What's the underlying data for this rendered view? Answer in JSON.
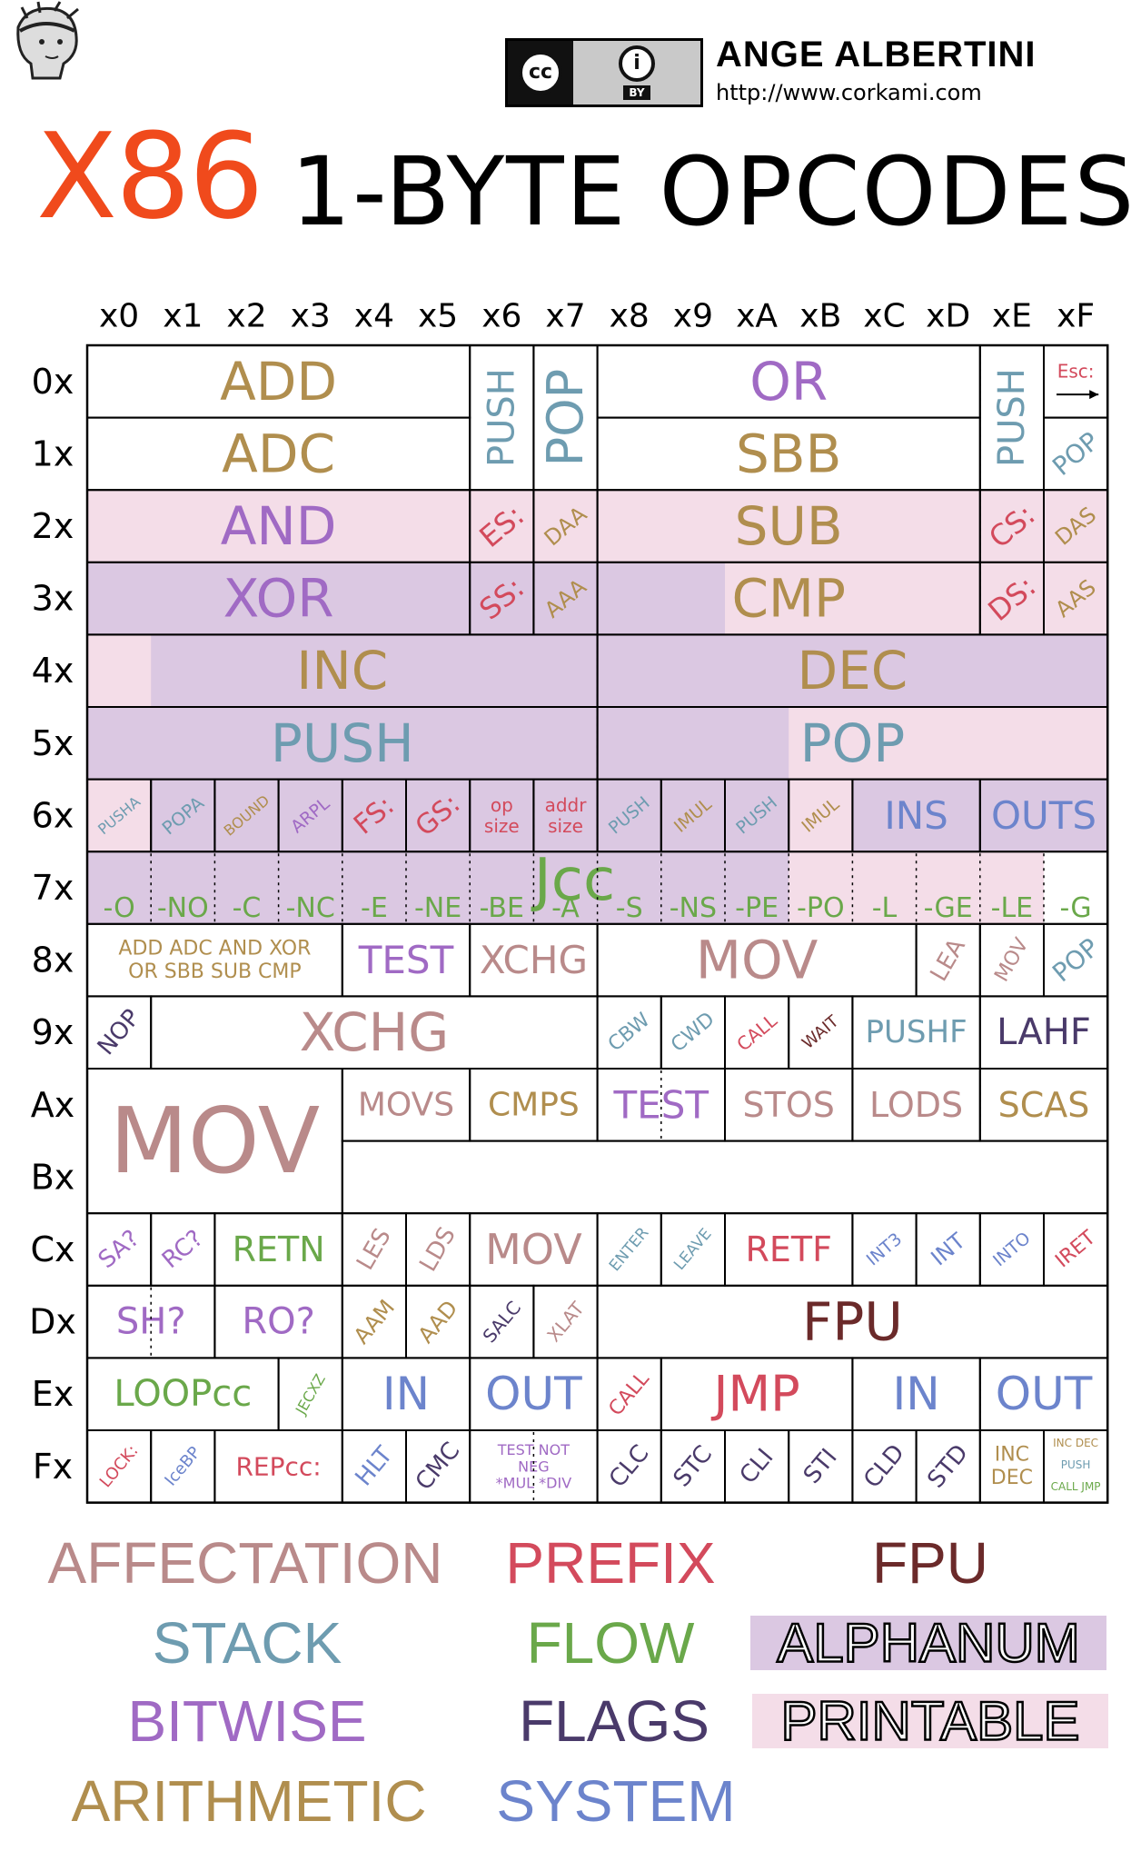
{
  "header": {
    "title_x86": "X86",
    "title_rest": "1-BYTE OPCODES",
    "author": "ANGE ALBERTINI",
    "url": "http://www.corkami.com",
    "license_cc": "cc",
    "license_by": "BY"
  },
  "colors": {
    "affectation": "#b98a8a",
    "prefix": "#d34a5c",
    "fpu": "#6b2a2a",
    "stack": "#6e9cb0",
    "flow": "#6aa84a",
    "bitwise": "#a06ac4",
    "flags": "#4a3a6a",
    "arithmetic": "#b08e4e",
    "system": "#6c84cc",
    "alphanum_bg": "#dbc8e2",
    "printable_bg": "#f4dde8"
  },
  "columns": [
    "x0",
    "x1",
    "x2",
    "x3",
    "x4",
    "x5",
    "x6",
    "x7",
    "x8",
    "x9",
    "xA",
    "xB",
    "xC",
    "xD",
    "xE",
    "xF"
  ],
  "rows": [
    "0x",
    "1x",
    "2x",
    "3x",
    "4x",
    "5x",
    "6x",
    "7x",
    "8x",
    "9x",
    "Ax",
    "Bx",
    "Cx",
    "Dx",
    "Ex",
    "Fx"
  ],
  "backgrounds": [
    {
      "r": 2,
      "c": 0,
      "w": 16,
      "h": 1,
      "cat": "printable_bg"
    },
    {
      "r": 3,
      "c": 0,
      "w": 16,
      "h": 1,
      "cat": "printable_bg"
    },
    {
      "r": 3,
      "c": 0,
      "w": 10,
      "h": 1,
      "cat": "alphanum_bg"
    },
    {
      "r": 4,
      "c": 0,
      "w": 16,
      "h": 2,
      "cat": "printable_bg"
    },
    {
      "r": 4,
      "c": 1,
      "w": 15,
      "h": 1,
      "cat": "alphanum_bg"
    },
    {
      "r": 5,
      "c": 0,
      "w": 11,
      "h": 1,
      "cat": "alphanum_bg"
    },
    {
      "r": 6,
      "c": 0,
      "w": 16,
      "h": 2,
      "cat": "printable_bg"
    },
    {
      "r": 6,
      "c": 1,
      "w": 10,
      "h": 1,
      "cat": "alphanum_bg"
    },
    {
      "r": 6,
      "c": 12,
      "w": 4,
      "h": 1,
      "cat": "alphanum_bg"
    },
    {
      "r": 7,
      "c": 0,
      "w": 11,
      "h": 1,
      "cat": "alphanum_bg"
    },
    {
      "r": 7,
      "c": 15,
      "w": 1,
      "h": 1,
      "cat": "white"
    }
  ],
  "cells": [
    {
      "r": 0,
      "c": 0,
      "w": 6,
      "h": 1,
      "lines": [
        "ADD"
      ],
      "cat": "arithmetic",
      "size": 58
    },
    {
      "r": 1,
      "c": 0,
      "w": 6,
      "h": 1,
      "lines": [
        "ADC"
      ],
      "cat": "arithmetic",
      "size": 58
    },
    {
      "r": 2,
      "c": 0,
      "w": 6,
      "h": 1,
      "lines": [
        "AND"
      ],
      "cat": "bitwise",
      "size": 58
    },
    {
      "r": 3,
      "c": 0,
      "w": 6,
      "h": 1,
      "lines": [
        "XOR"
      ],
      "cat": "bitwise",
      "size": 58
    },
    {
      "r": 0,
      "c": 6,
      "w": 1,
      "h": 2,
      "lines": [
        "PUSH"
      ],
      "cat": "stack",
      "size": 40,
      "rot": -90
    },
    {
      "r": 0,
      "c": 7,
      "w": 1,
      "h": 2,
      "lines": [
        "POP"
      ],
      "cat": "stack",
      "size": 54,
      "rot": -90
    },
    {
      "r": 2,
      "c": 6,
      "w": 1,
      "h": 1,
      "lines": [
        "ES:"
      ],
      "cat": "prefix",
      "size": 32,
      "rot": -40
    },
    {
      "r": 2,
      "c": 7,
      "w": 1,
      "h": 1,
      "lines": [
        "DAA"
      ],
      "cat": "arithmetic",
      "size": 24,
      "rot": -40
    },
    {
      "r": 3,
      "c": 6,
      "w": 1,
      "h": 1,
      "lines": [
        "SS:"
      ],
      "cat": "prefix",
      "size": 32,
      "rot": -40
    },
    {
      "r": 3,
      "c": 7,
      "w": 1,
      "h": 1,
      "lines": [
        "AAA"
      ],
      "cat": "arithmetic",
      "size": 24,
      "rot": -40
    },
    {
      "r": 0,
      "c": 8,
      "w": 6,
      "h": 1,
      "lines": [
        "OR"
      ],
      "cat": "bitwise",
      "size": 58
    },
    {
      "r": 1,
      "c": 8,
      "w": 6,
      "h": 1,
      "lines": [
        "SBB"
      ],
      "cat": "arithmetic",
      "size": 58
    },
    {
      "r": 2,
      "c": 8,
      "w": 6,
      "h": 1,
      "lines": [
        "SUB"
      ],
      "cat": "arithmetic",
      "size": 58
    },
    {
      "r": 3,
      "c": 8,
      "w": 6,
      "h": 1,
      "lines": [
        "CMP"
      ],
      "cat": "arithmetic",
      "size": 58
    },
    {
      "r": 0,
      "c": 14,
      "w": 1,
      "h": 2,
      "lines": [
        "PUSH"
      ],
      "cat": "stack",
      "size": 40,
      "rot": -90
    },
    {
      "r": 0,
      "c": 15,
      "w": 1,
      "h": 1,
      "lines": [
        "Esc:"
      ],
      "cat": "prefix",
      "size": 20,
      "arrow": true
    },
    {
      "r": 1,
      "c": 15,
      "w": 1,
      "h": 1,
      "lines": [
        "POP"
      ],
      "cat": "stack",
      "size": 28,
      "rot": -40
    },
    {
      "r": 2,
      "c": 14,
      "w": 1,
      "h": 1,
      "lines": [
        "CS:"
      ],
      "cat": "prefix",
      "size": 32,
      "rot": -40
    },
    {
      "r": 2,
      "c": 15,
      "w": 1,
      "h": 1,
      "lines": [
        "DAS"
      ],
      "cat": "arithmetic",
      "size": 24,
      "rot": -40
    },
    {
      "r": 3,
      "c": 14,
      "w": 1,
      "h": 1,
      "lines": [
        "DS:"
      ],
      "cat": "prefix",
      "size": 32,
      "rot": -40
    },
    {
      "r": 3,
      "c": 15,
      "w": 1,
      "h": 1,
      "lines": [
        "AAS"
      ],
      "cat": "arithmetic",
      "size": 24,
      "rot": -40
    },
    {
      "r": 4,
      "c": 0,
      "w": 8,
      "h": 1,
      "lines": [
        "INC"
      ],
      "cat": "arithmetic",
      "size": 58
    },
    {
      "r": 4,
      "c": 8,
      "w": 8,
      "h": 1,
      "lines": [
        "DEC"
      ],
      "cat": "arithmetic",
      "size": 58
    },
    {
      "r": 5,
      "c": 0,
      "w": 8,
      "h": 1,
      "lines": [
        "PUSH"
      ],
      "cat": "stack",
      "size": 58
    },
    {
      "r": 5,
      "c": 8,
      "w": 8,
      "h": 1,
      "lines": [
        "POP"
      ],
      "cat": "stack",
      "size": 58
    },
    {
      "r": 6,
      "c": 0,
      "w": 1,
      "h": 1,
      "lines": [
        "PUSHA"
      ],
      "cat": "stack",
      "size": 16,
      "rot": -40
    },
    {
      "r": 6,
      "c": 1,
      "w": 1,
      "h": 1,
      "lines": [
        "POPA"
      ],
      "cat": "stack",
      "size": 20,
      "rot": -40
    },
    {
      "r": 6,
      "c": 2,
      "w": 1,
      "h": 1,
      "lines": [
        "BOUND"
      ],
      "cat": "arithmetic",
      "size": 16,
      "rot": -40
    },
    {
      "r": 6,
      "c": 3,
      "w": 1,
      "h": 1,
      "lines": [
        "ARPL"
      ],
      "cat": "bitwise",
      "size": 19,
      "rot": -40
    },
    {
      "r": 6,
      "c": 4,
      "w": 1,
      "h": 1,
      "lines": [
        "FS:"
      ],
      "cat": "prefix",
      "size": 30,
      "rot": -40
    },
    {
      "r": 6,
      "c": 5,
      "w": 1,
      "h": 1,
      "lines": [
        "GS:"
      ],
      "cat": "prefix",
      "size": 30,
      "rot": -40
    },
    {
      "r": 6,
      "c": 6,
      "w": 1,
      "h": 1,
      "lines": [
        "op",
        "size"
      ],
      "cat": "prefix",
      "size": 20
    },
    {
      "r": 6,
      "c": 7,
      "w": 1,
      "h": 1,
      "lines": [
        "addr",
        "size"
      ],
      "cat": "prefix",
      "size": 20
    },
    {
      "r": 6,
      "c": 8,
      "w": 1,
      "h": 1,
      "lines": [
        "PUSH"
      ],
      "cat": "stack",
      "size": 19,
      "rot": -40
    },
    {
      "r": 6,
      "c": 9,
      "w": 1,
      "h": 1,
      "lines": [
        "IMUL"
      ],
      "cat": "arithmetic",
      "size": 19,
      "rot": -40
    },
    {
      "r": 6,
      "c": 10,
      "w": 1,
      "h": 1,
      "lines": [
        "PUSH"
      ],
      "cat": "stack",
      "size": 19,
      "rot": -40
    },
    {
      "r": 6,
      "c": 11,
      "w": 1,
      "h": 1,
      "lines": [
        "IMUL"
      ],
      "cat": "arithmetic",
      "size": 19,
      "rot": -40
    },
    {
      "r": 6,
      "c": 12,
      "w": 2,
      "h": 1,
      "lines": [
        "INS"
      ],
      "cat": "system",
      "size": 42
    },
    {
      "r": 6,
      "c": 14,
      "w": 2,
      "h": 1,
      "lines": [
        "OUTS"
      ],
      "cat": "system",
      "size": 42
    },
    {
      "r": 8,
      "c": 0,
      "w": 4,
      "h": 1,
      "lines": [
        "ADD  ADC  AND  XOR",
        "OR   SBB  SUB  CMP"
      ],
      "cat": "arithmetic",
      "size": 22
    },
    {
      "r": 8,
      "c": 4,
      "w": 2,
      "h": 1,
      "lines": [
        "TEST"
      ],
      "cat": "bitwise",
      "size": 42
    },
    {
      "r": 8,
      "c": 6,
      "w": 2,
      "h": 1,
      "lines": [
        "XCHG"
      ],
      "cat": "affectation",
      "size": 42
    },
    {
      "r": 8,
      "c": 8,
      "w": 5,
      "h": 1,
      "lines": [
        "MOV"
      ],
      "cat": "affectation",
      "size": 58
    },
    {
      "r": 8,
      "c": 13,
      "w": 1,
      "h": 1,
      "lines": [
        "LEA"
      ],
      "cat": "affectation",
      "size": 26,
      "rot": -60
    },
    {
      "r": 8,
      "c": 14,
      "w": 1,
      "h": 1,
      "lines": [
        "MOV"
      ],
      "cat": "affectation",
      "size": 22,
      "rot": -60
    },
    {
      "r": 8,
      "c": 15,
      "w": 1,
      "h": 1,
      "lines": [
        "POP"
      ],
      "cat": "stack",
      "size": 28,
      "rot": -40
    },
    {
      "r": 9,
      "c": 0,
      "w": 1,
      "h": 1,
      "lines": [
        "NOP"
      ],
      "cat": "flags",
      "size": 26,
      "rot": -50
    },
    {
      "r": 9,
      "c": 1,
      "w": 7,
      "h": 1,
      "lines": [
        "XCHG"
      ],
      "cat": "affectation",
      "size": 58
    },
    {
      "r": 9,
      "c": 8,
      "w": 1,
      "h": 1,
      "lines": [
        "CBW"
      ],
      "cat": "stack",
      "size": 22,
      "rot": -40
    },
    {
      "r": 9,
      "c": 9,
      "w": 1,
      "h": 1,
      "lines": [
        "CWD"
      ],
      "cat": "stack",
      "size": 22,
      "rot": -40
    },
    {
      "r": 9,
      "c": 10,
      "w": 1,
      "h": 1,
      "lines": [
        "CALL"
      ],
      "cat": "prefix",
      "size": 20,
      "rot": -40
    },
    {
      "r": 9,
      "c": 11,
      "w": 1,
      "h": 1,
      "lines": [
        "WAIT"
      ],
      "cat": "fpu",
      "size": 18,
      "rot": -40
    },
    {
      "r": 9,
      "c": 12,
      "w": 2,
      "h": 1,
      "lines": [
        "PUSHF"
      ],
      "cat": "stack",
      "size": 34
    },
    {
      "r": 9,
      "c": 14,
      "w": 2,
      "h": 1,
      "lines": [
        "LAHF"
      ],
      "cat": "flags",
      "size": 40
    },
    {
      "r": 10,
      "c": 0,
      "w": 4,
      "h": 2,
      "lines": [
        "MOV"
      ],
      "cat": "affectation",
      "size": 100
    },
    {
      "r": 10,
      "c": 4,
      "w": 2,
      "h": 1,
      "lines": [
        "MOVS"
      ],
      "cat": "affectation",
      "size": 36
    },
    {
      "r": 10,
      "c": 6,
      "w": 2,
      "h": 1,
      "lines": [
        "CMPS"
      ],
      "cat": "arithmetic",
      "size": 36
    },
    {
      "r": 10,
      "c": 8,
      "w": 2,
      "h": 1,
      "lines": [
        "TEST"
      ],
      "cat": "bitwise",
      "size": 42
    },
    {
      "r": 10,
      "c": 10,
      "w": 2,
      "h": 1,
      "lines": [
        "STOS"
      ],
      "cat": "affectation",
      "size": 38
    },
    {
      "r": 10,
      "c": 12,
      "w": 2,
      "h": 1,
      "lines": [
        "LODS"
      ],
      "cat": "affectation",
      "size": 38
    },
    {
      "r": 10,
      "c": 14,
      "w": 2,
      "h": 1,
      "lines": [
        "SCAS"
      ],
      "cat": "arithmetic",
      "size": 38
    },
    {
      "r": 11,
      "c": 4,
      "w": 12,
      "h": 1,
      "lines": [
        ""
      ],
      "cat": "affectation",
      "size": 20
    },
    {
      "r": 12,
      "c": 0,
      "w": 1,
      "h": 1,
      "lines": [
        "SA?"
      ],
      "cat": "bitwise",
      "size": 26,
      "rot": -40
    },
    {
      "r": 12,
      "c": 1,
      "w": 1,
      "h": 1,
      "lines": [
        "RC?"
      ],
      "cat": "bitwise",
      "size": 26,
      "rot": -40
    },
    {
      "r": 12,
      "c": 2,
      "w": 2,
      "h": 1,
      "lines": [
        "RETN"
      ],
      "cat": "flow",
      "size": 38
    },
    {
      "r": 12,
      "c": 4,
      "w": 1,
      "h": 1,
      "lines": [
        "LES"
      ],
      "cat": "affectation",
      "size": 26,
      "rot": -60
    },
    {
      "r": 12,
      "c": 5,
      "w": 1,
      "h": 1,
      "lines": [
        "LDS"
      ],
      "cat": "affectation",
      "size": 26,
      "rot": -60
    },
    {
      "r": 12,
      "c": 6,
      "w": 2,
      "h": 1,
      "lines": [
        "MOV"
      ],
      "cat": "affectation",
      "size": 46
    },
    {
      "r": 12,
      "c": 8,
      "w": 1,
      "h": 1,
      "lines": [
        "ENTER"
      ],
      "cat": "stack",
      "size": 17,
      "rot": -50
    },
    {
      "r": 12,
      "c": 9,
      "w": 1,
      "h": 1,
      "lines": [
        "LEAVE"
      ],
      "cat": "stack",
      "size": 17,
      "rot": -50
    },
    {
      "r": 12,
      "c": 10,
      "w": 2,
      "h": 1,
      "lines": [
        "RETF"
      ],
      "cat": "prefix",
      "size": 38
    },
    {
      "r": 12,
      "c": 12,
      "w": 1,
      "h": 1,
      "lines": [
        "INT3"
      ],
      "cat": "system",
      "size": 19,
      "rot": -40
    },
    {
      "r": 12,
      "c": 13,
      "w": 1,
      "h": 1,
      "lines": [
        "INT"
      ],
      "cat": "system",
      "size": 24,
      "rot": -40
    },
    {
      "r": 12,
      "c": 14,
      "w": 1,
      "h": 1,
      "lines": [
        "INTO"
      ],
      "cat": "system",
      "size": 19,
      "rot": -40
    },
    {
      "r": 12,
      "c": 15,
      "w": 1,
      "h": 1,
      "lines": [
        "IRET"
      ],
      "cat": "prefix",
      "size": 22,
      "rot": -40
    },
    {
      "r": 13,
      "c": 0,
      "w": 2,
      "h": 1,
      "lines": [
        "SH?"
      ],
      "cat": "bitwise",
      "size": 40
    },
    {
      "r": 13,
      "c": 2,
      "w": 2,
      "h": 1,
      "lines": [
        "RO?"
      ],
      "cat": "bitwise",
      "size": 40
    },
    {
      "r": 13,
      "c": 4,
      "w": 1,
      "h": 1,
      "lines": [
        "AAM"
      ],
      "cat": "arithmetic",
      "size": 24,
      "rot": -50
    },
    {
      "r": 13,
      "c": 5,
      "w": 1,
      "h": 1,
      "lines": [
        "AAD"
      ],
      "cat": "arithmetic",
      "size": 24,
      "rot": -50
    },
    {
      "r": 13,
      "c": 6,
      "w": 1,
      "h": 1,
      "lines": [
        "SALC"
      ],
      "cat": "flags",
      "size": 20,
      "rot": -50
    },
    {
      "r": 13,
      "c": 7,
      "w": 1,
      "h": 1,
      "lines": [
        "XLAT"
      ],
      "cat": "affectation",
      "size": 20,
      "rot": -50
    },
    {
      "r": 13,
      "c": 8,
      "w": 8,
      "h": 1,
      "lines": [
        "FPU"
      ],
      "cat": "fpu",
      "size": 58
    },
    {
      "r": 14,
      "c": 0,
      "w": 3,
      "h": 1,
      "lines": [
        "LOOPcc"
      ],
      "cat": "flow",
      "size": 40
    },
    {
      "r": 14,
      "c": 3,
      "w": 1,
      "h": 1,
      "lines": [
        "JECXZ"
      ],
      "cat": "flow",
      "size": 16,
      "rot": -60
    },
    {
      "r": 14,
      "c": 4,
      "w": 2,
      "h": 1,
      "lines": [
        "IN"
      ],
      "cat": "system",
      "size": 50
    },
    {
      "r": 14,
      "c": 6,
      "w": 2,
      "h": 1,
      "lines": [
        "OUT"
      ],
      "cat": "system",
      "size": 50
    },
    {
      "r": 14,
      "c": 8,
      "w": 1,
      "h": 1,
      "lines": [
        "CALL"
      ],
      "cat": "prefix",
      "size": 22,
      "rot": -50
    },
    {
      "r": 14,
      "c": 9,
      "w": 3,
      "h": 1,
      "lines": [
        "JMP"
      ],
      "cat": "prefix",
      "size": 54
    },
    {
      "r": 14,
      "c": 12,
      "w": 2,
      "h": 1,
      "lines": [
        "IN"
      ],
      "cat": "system",
      "size": 50
    },
    {
      "r": 14,
      "c": 14,
      "w": 2,
      "h": 1,
      "lines": [
        "OUT"
      ],
      "cat": "system",
      "size": 50
    },
    {
      "r": 15,
      "c": 0,
      "w": 1,
      "h": 1,
      "lines": [
        "LOCK:"
      ],
      "cat": "prefix",
      "size": 18,
      "rot": -50
    },
    {
      "r": 15,
      "c": 1,
      "w": 1,
      "h": 1,
      "lines": [
        "IceBP"
      ],
      "cat": "system",
      "size": 18,
      "rot": -50
    },
    {
      "r": 15,
      "c": 2,
      "w": 2,
      "h": 1,
      "lines": [
        "REPcc:"
      ],
      "cat": "prefix",
      "size": 28
    },
    {
      "r": 15,
      "c": 4,
      "w": 1,
      "h": 1,
      "lines": [
        "HLT"
      ],
      "cat": "system",
      "size": 26,
      "rot": -50
    },
    {
      "r": 15,
      "c": 5,
      "w": 1,
      "h": 1,
      "lines": [
        "CMC"
      ],
      "cat": "flags",
      "size": 26,
      "rot": -50
    },
    {
      "r": 15,
      "c": 6,
      "w": 2,
      "h": 1,
      "lines": [
        "TEST  NOT",
        "NEG",
        "*MUL  *DIV"
      ],
      "cat": "bitwise",
      "size": 16
    },
    {
      "r": 15,
      "c": 8,
      "w": 1,
      "h": 1,
      "lines": [
        "CLC"
      ],
      "cat": "flags",
      "size": 26,
      "rot": -50
    },
    {
      "r": 15,
      "c": 9,
      "w": 1,
      "h": 1,
      "lines": [
        "STC"
      ],
      "cat": "flags",
      "size": 26,
      "rot": -50
    },
    {
      "r": 15,
      "c": 10,
      "w": 1,
      "h": 1,
      "lines": [
        "CLI"
      ],
      "cat": "flags",
      "size": 26,
      "rot": -50
    },
    {
      "r": 15,
      "c": 11,
      "w": 1,
      "h": 1,
      "lines": [
        "STI"
      ],
      "cat": "flags",
      "size": 26,
      "rot": -50
    },
    {
      "r": 15,
      "c": 12,
      "w": 1,
      "h": 1,
      "lines": [
        "CLD"
      ],
      "cat": "flags",
      "size": 26,
      "rot": -50
    },
    {
      "r": 15,
      "c": 13,
      "w": 1,
      "h": 1,
      "lines": [
        "STD"
      ],
      "cat": "flags",
      "size": 26,
      "rot": -50
    },
    {
      "r": 15,
      "c": 14,
      "w": 1,
      "h": 1,
      "lines": [
        "INC",
        "DEC"
      ],
      "cat": "arithmetic",
      "size": 22
    },
    {
      "r": 15,
      "c": 15,
      "w": 1,
      "h": 1,
      "lines": [
        "INC DEC",
        "PUSH",
        "CALL JMP"
      ],
      "cat": "mixed",
      "size": 12
    }
  ],
  "jcc": {
    "title": "Jcc",
    "labels": [
      "-O",
      "-NO",
      "-C",
      "-NC",
      "-E",
      "-NE",
      "-BE",
      "-A",
      "-S",
      "-NS",
      "-PE",
      "-PO",
      "-L",
      "-GE",
      "-LE",
      "-G"
    ]
  },
  "legend": [
    {
      "label": "AFFECTATION",
      "cat": "affectation"
    },
    {
      "label": "PREFIX",
      "cat": "prefix"
    },
    {
      "label": "FPU",
      "cat": "fpu"
    },
    {
      "label": "STACK",
      "cat": "stack"
    },
    {
      "label": "FLOW",
      "cat": "flow"
    },
    {
      "label": "ALPHANUM",
      "cat": "alphanum_bg",
      "outline": true
    },
    {
      "label": "BITWISE",
      "cat": "bitwise"
    },
    {
      "label": "FLAGS",
      "cat": "flags"
    },
    {
      "label": "PRINTABLE",
      "cat": "printable_bg",
      "outline": true
    },
    {
      "label": "ARITHMETIC",
      "cat": "arithmetic"
    },
    {
      "label": "SYSTEM",
      "cat": "system"
    }
  ]
}
